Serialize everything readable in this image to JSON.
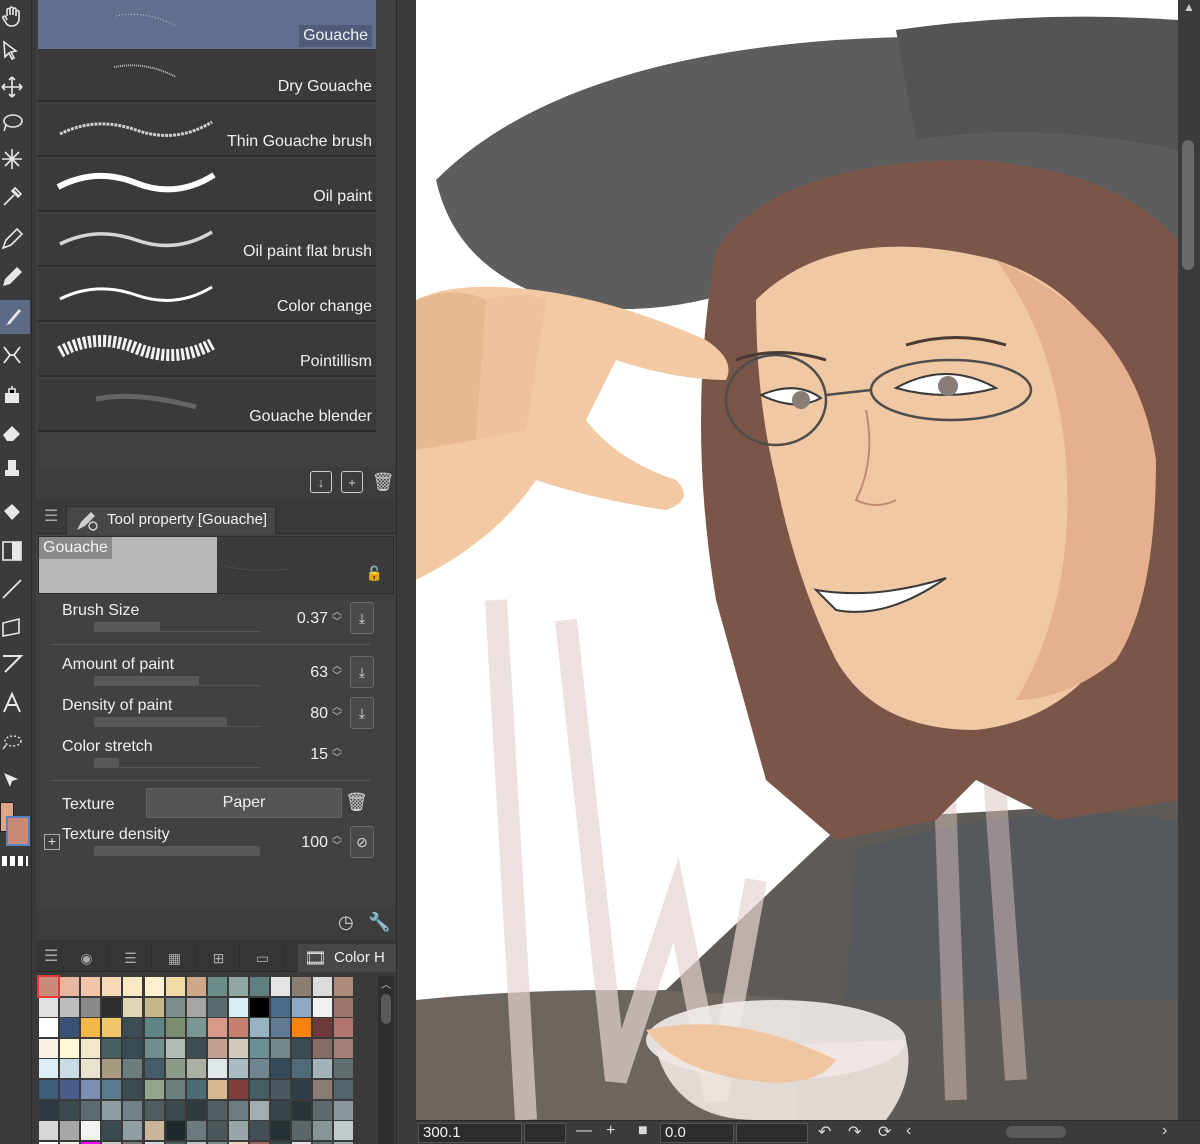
{
  "brushes": [
    {
      "label": "Gouache",
      "selected": true
    },
    {
      "label": "Dry Gouache",
      "selected": false
    },
    {
      "label": "Thin Gouache brush",
      "selected": false
    },
    {
      "label": "Oil paint",
      "selected": false
    },
    {
      "label": "Oil paint flat brush",
      "selected": false
    },
    {
      "label": "Color change",
      "selected": false
    },
    {
      "label": "Pointillism",
      "selected": false
    },
    {
      "label": "Gouache blender",
      "selected": false
    }
  ],
  "tool_property": {
    "tab_title": "Tool property [Gouache]",
    "preview_label": "Gouache",
    "brush_size": {
      "label": "Brush Size",
      "value": "0.37",
      "fraction": 0.4
    },
    "amount_of_paint": {
      "label": "Amount of paint",
      "value": "63",
      "fraction": 0.63
    },
    "density_of_paint": {
      "label": "Density of paint",
      "value": "80",
      "fraction": 0.8
    },
    "color_stretch": {
      "label": "Color stretch",
      "value": "15",
      "fraction": 0.15
    },
    "texture": {
      "label": "Texture",
      "value": "Paper"
    },
    "texture_density": {
      "label": "Texture density",
      "value": "100",
      "fraction": 1.0
    }
  },
  "palette": {
    "active_tab": "Color H",
    "colors": {
      "main": "#e0a488",
      "sub": "#c98a74"
    }
  },
  "status": {
    "zoom": "300.1",
    "angle": "0.0"
  }
}
